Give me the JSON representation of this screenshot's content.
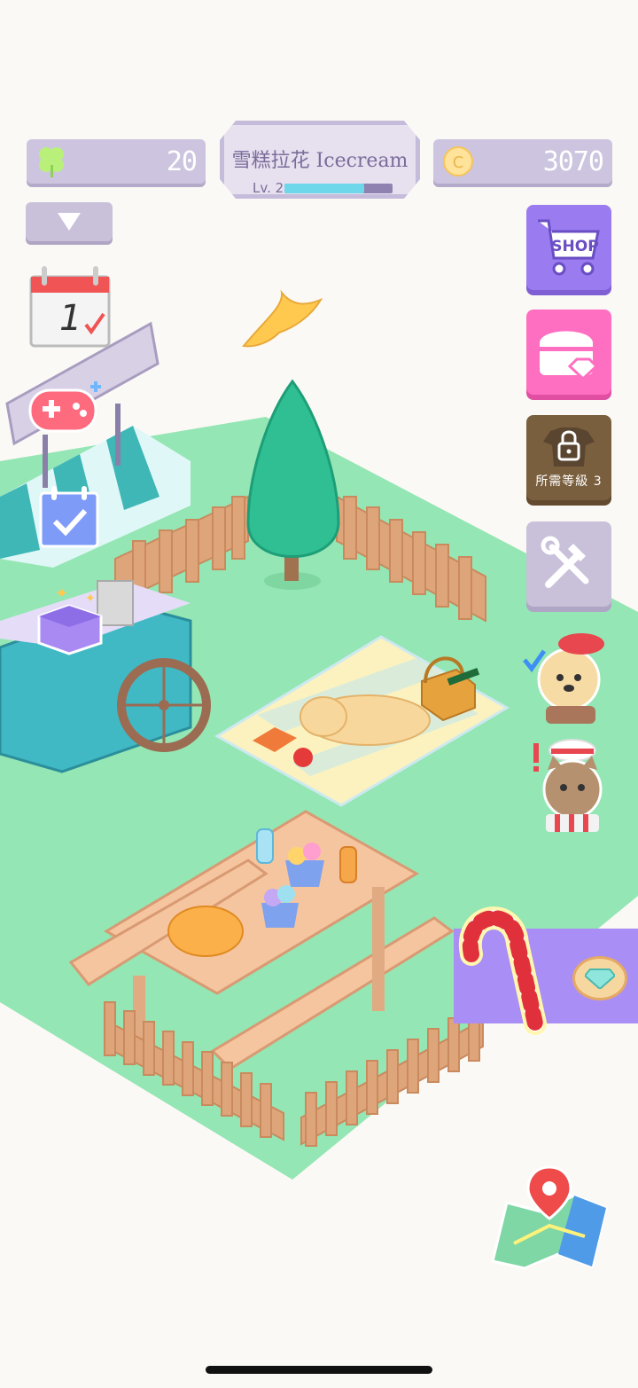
{
  "hud": {
    "clover_count": "20",
    "coin_count": "3070",
    "shop_title": "雪糕拉花 Icecream",
    "level_label": "Lv. 2",
    "xp_progress": 0.74
  },
  "buttons": {
    "shop_label": "SHOP",
    "locked_label": "所需等級 3"
  },
  "calendar": {
    "day": "1"
  },
  "colors": {
    "grass": "#94e6b4",
    "hud_purple": "#cdc5df",
    "shop_purple": "#9b7bf0",
    "gift_pink": "#ff6fc1",
    "locked_brown": "#7a5f3e",
    "accent_cyan": "#6fd7ea"
  }
}
